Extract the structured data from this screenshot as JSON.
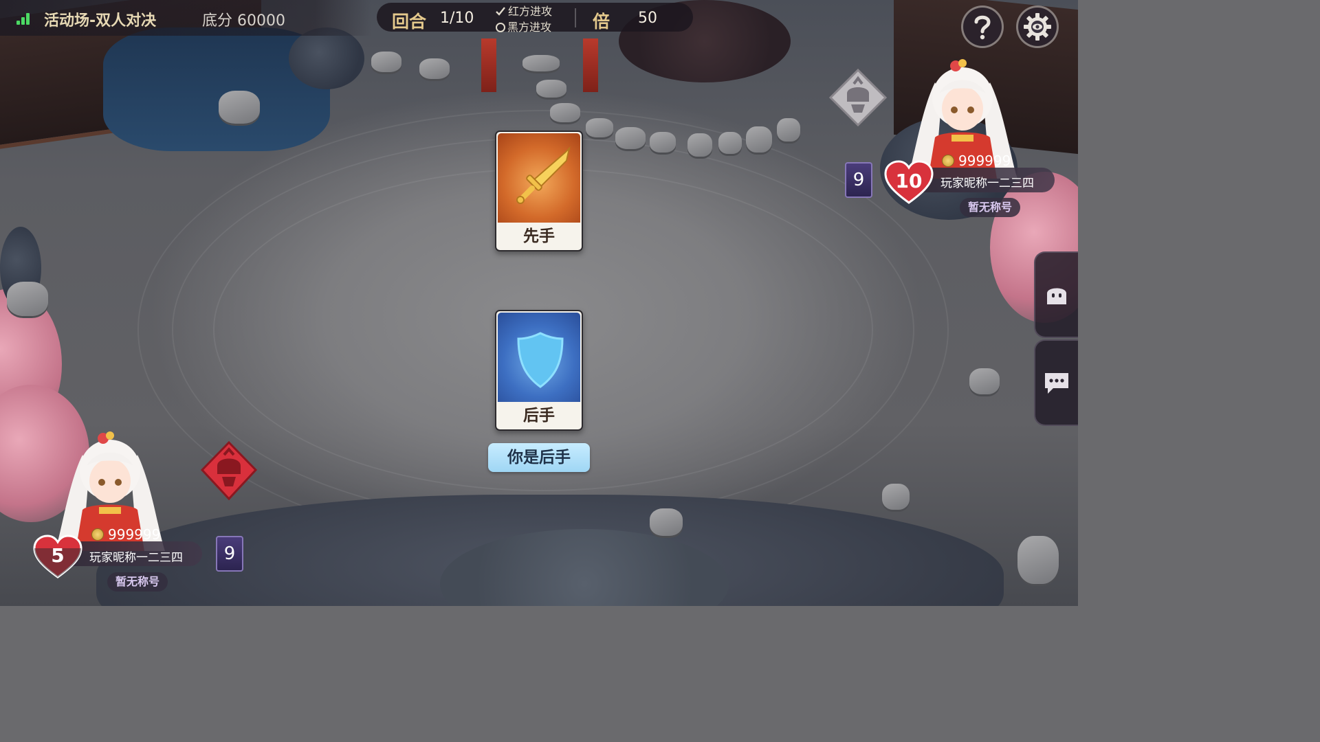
{
  "header": {
    "mode_label": "活动场-双人对决",
    "base_score_label": "底分 60000",
    "round_label": "回合",
    "round_value": "1/10",
    "attack_options": [
      {
        "label": "红方进攻",
        "state": "checked"
      },
      {
        "label": "黑方进攻",
        "state": "unchecked"
      }
    ],
    "multiplier_label": "倍",
    "multiplier_value": "50",
    "icons": {
      "signal": "signal-icon",
      "help": "help-icon",
      "settings": "settings-icon"
    }
  },
  "cards": {
    "first": {
      "label": "先手",
      "icon": "sword-icon"
    },
    "second": {
      "label": "后手",
      "icon": "shield-icon"
    }
  },
  "turn_banner": "你是后手",
  "opponent": {
    "coins": "999999",
    "nickname": "玩家昵称一二三四",
    "title": "暂无称号",
    "hp": "10",
    "card_count": "9",
    "faction_icon": "samurai-helmet-icon",
    "faction_color": "#b9b5ba"
  },
  "self": {
    "coins": "999999",
    "nickname": "玩家昵称一二三四",
    "title": "暂无称号",
    "hp": "5",
    "card_count": "9",
    "faction_icon": "samurai-helmet-icon",
    "faction_color": "#d9303c"
  },
  "side_tabs": [
    {
      "icon": "emoji-icon"
    },
    {
      "icon": "chat-icon"
    }
  ],
  "colors": {
    "accent_gold": "#e4c98c",
    "heart_red": "#d8323c",
    "banner_blue": "#9fd6f4"
  }
}
